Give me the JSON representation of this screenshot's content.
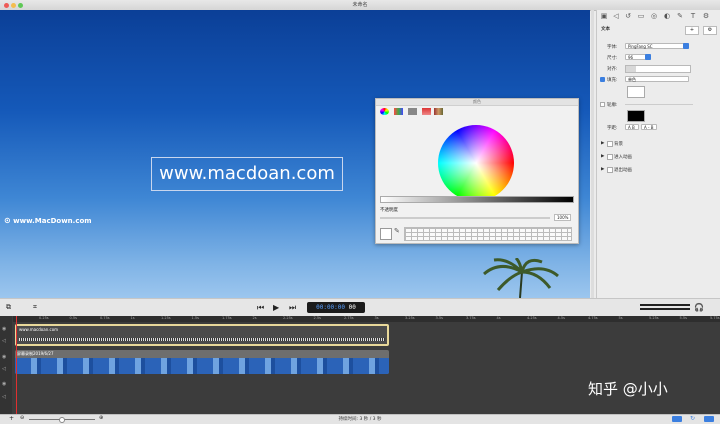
{
  "window": {
    "title": "未命名"
  },
  "preview": {
    "text_overlay": "www.macdoan.com",
    "watermark": "www.MacDown.com"
  },
  "colors_panel": {
    "title": "颜色",
    "opacity_label": "不透明度",
    "opacity_value": "100%"
  },
  "inspector": {
    "section_title": "文本",
    "font_label": "字体:",
    "font_value": "PingFang SC",
    "size_label": "尺寸:",
    "size_value": "96",
    "align_label": "对齐:",
    "fill_label": "填充:",
    "fill_value": "单色",
    "outline_label": "轮廓:",
    "style_label": "字距:",
    "style_values": [
      "A B",
      "A - B"
    ],
    "sections": [
      "背景",
      "进入动画",
      "退出动画"
    ]
  },
  "toolbar": {
    "timecode": "00:00:00",
    "timecode_frames": "00"
  },
  "timeline": {
    "ruler_ticks": [
      "0.25s",
      "0.5s",
      "0.75s",
      "1s",
      "1.25s",
      "1.5s",
      "1.75s",
      "2s",
      "2.25s",
      "2.5s",
      "2.75s",
      "3s",
      "3.25s",
      "3.5s",
      "3.75s",
      "4s",
      "4.25s",
      "4.5s",
      "4.75s",
      "5s",
      "5.25s",
      "5.5s",
      "5.75s"
    ],
    "clips": [
      {
        "label": "www.macdoan.com"
      },
      {
        "label": "屏幕录制2019/6/27"
      }
    ]
  },
  "status": {
    "duration": "持续时间: 3 秒  /  3 秒"
  },
  "overlay_watermark": "知乎 @小小",
  "colors": {
    "accent": "#3b7fe0",
    "clip_border": "#e8d89a",
    "playhead": "#e03030"
  }
}
